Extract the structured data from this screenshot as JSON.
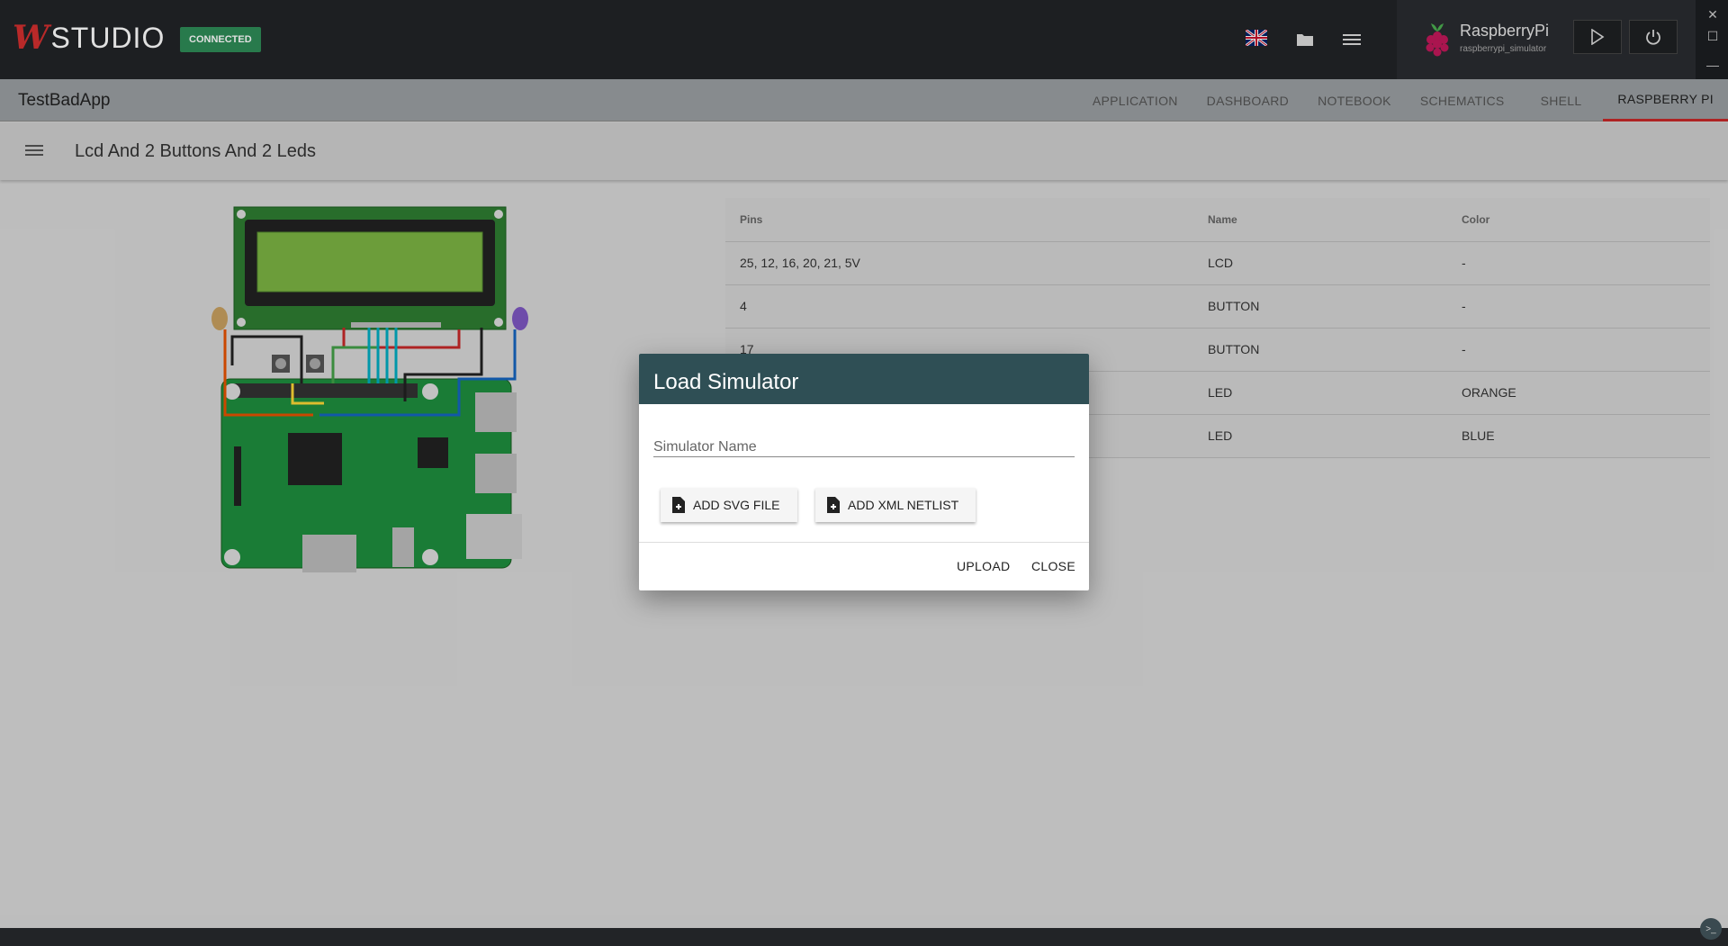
{
  "topbar": {
    "logo_mark": "W",
    "logo_text": "STUDIO",
    "status_badge": "CONNECTED",
    "device": {
      "name": "RaspberryPi",
      "subtitle": "raspberrypi_simulator"
    }
  },
  "tabbar": {
    "app_title": "TestBadApp",
    "tabs": [
      {
        "label": "APPLICATION"
      },
      {
        "label": "DASHBOARD"
      },
      {
        "label": "NOTEBOOK"
      },
      {
        "label": "SCHEMATICS"
      },
      {
        "label": "SHELL"
      },
      {
        "label": "RASPBERRY PI"
      }
    ]
  },
  "subheader": {
    "title": "Lcd And 2 Buttons And 2 Leds"
  },
  "table": {
    "headers": [
      "Pins",
      "Name",
      "Color"
    ],
    "rows": [
      [
        "25, 12, 16, 20, 21, 5V",
        "LCD",
        "-"
      ],
      [
        "4",
        "BUTTON",
        "-"
      ],
      [
        "17",
        "BUTTON",
        "-"
      ],
      [
        "",
        "LED",
        "ORANGE"
      ],
      [
        "",
        "LED",
        "BLUE"
      ]
    ]
  },
  "dialog": {
    "title": "Load Simulator",
    "input_placeholder": "Simulator Name",
    "add_svg_label": "ADD SVG FILE",
    "add_xml_label": "ADD XML NETLIST",
    "upload_label": "UPLOAD",
    "close_label": "CLOSE"
  },
  "colors": {
    "accent": "#c62828",
    "dialog_header": "#2f4f55",
    "badge": "#2e8b57",
    "topbar": "#222427"
  }
}
